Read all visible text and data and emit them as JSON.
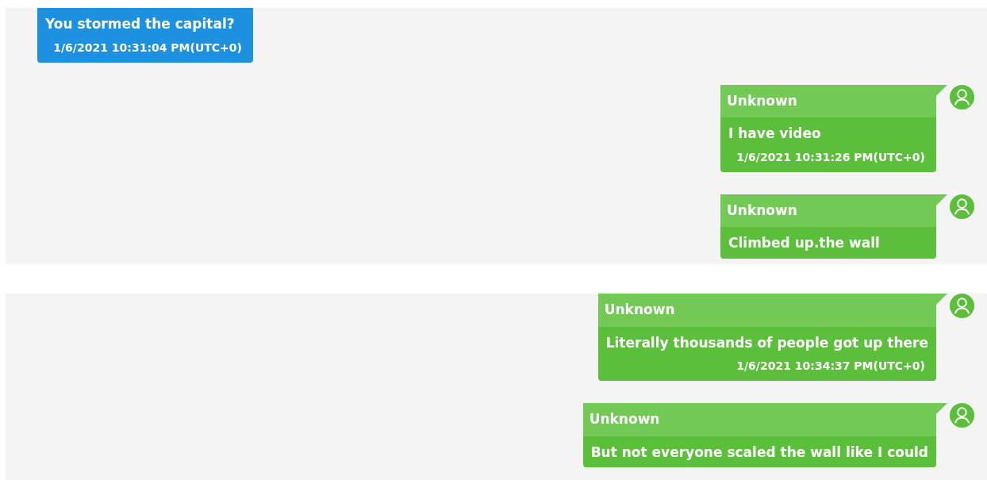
{
  "panels": [
    {
      "messages": [
        {
          "kind": "outgoing",
          "text": "You stormed the capital?",
          "time": "1/6/2021 10:31:04 PM(UTC+0)"
        },
        {
          "kind": "incoming",
          "sender": "Unknown",
          "text": "I have video",
          "time": "1/6/2021 10:31:26 PM(UTC+0)"
        },
        {
          "kind": "incoming",
          "sender": "Unknown",
          "text": "Climbed up.the wall"
        }
      ]
    },
    {
      "messages": [
        {
          "kind": "incoming",
          "sender": "Unknown",
          "text": "Literally thousands of people got up there",
          "time": "1/6/2021 10:34:37 PM(UTC+0)"
        },
        {
          "kind": "incoming",
          "sender": "Unknown",
          "text": "But not everyone scaled the wall like I could"
        }
      ]
    }
  ]
}
